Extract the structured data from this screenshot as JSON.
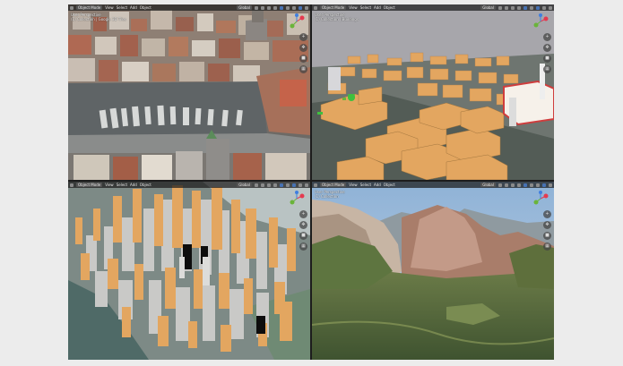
{
  "viewports": [
    {
      "header": {
        "mode": "Object Mode",
        "menus": [
          "View",
          "Select",
          "Add",
          "Object"
        ],
        "orientation": "Global"
      },
      "overlay": {
        "view_name": "User Perspective",
        "collection": "(1) Collection | Google 3D Tiles"
      }
    },
    {
      "header": {
        "mode": "Object Mode",
        "menus": [
          "View",
          "Select",
          "Add",
          "Object"
        ],
        "orientation": "Global"
      },
      "overlay": {
        "view_name": "User Perspective",
        "collection": "(1) Collection | Buildings"
      }
    },
    {
      "header": {
        "mode": "Object Mode",
        "menus": [
          "View",
          "Select",
          "Add",
          "Object"
        ],
        "orientation": "Global"
      },
      "overlay": {
        "view_name": "",
        "collection": ""
      }
    },
    {
      "header": {
        "mode": "Object Mode",
        "menus": [
          "View",
          "Select",
          "Add",
          "Object"
        ],
        "orientation": "Global"
      },
      "overlay": {
        "view_name": "User Perspective",
        "collection": "(1) Collection"
      }
    }
  ],
  "icons": {
    "header": [
      "editor-type-icon",
      "transform-pivot-icon",
      "snap-icon",
      "proportional-edit-icon",
      "visibility-icon",
      "overlay-icon",
      "xray-icon",
      "shading-solid-icon",
      "shading-material-icon",
      "shading-rendered-icon"
    ],
    "nav": [
      "zoom-icon",
      "pan-icon",
      "camera-icon",
      "perspective-icon"
    ]
  },
  "colors": {
    "frame": "#1d1d1d",
    "header": "#2b2b2b",
    "selection": "#4772b3",
    "building_orange": "#e3a660",
    "axis_x": "#e53a4f",
    "axis_y": "#6ab43a",
    "axis_z": "#3f7fe0"
  }
}
